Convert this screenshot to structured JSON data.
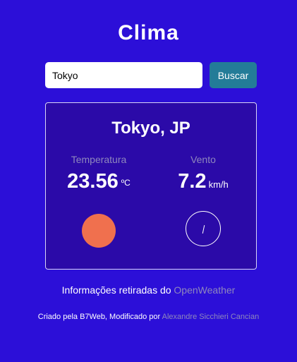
{
  "header": {
    "title": "Clima"
  },
  "search": {
    "value": "Tokyo",
    "button_label": "Buscar"
  },
  "result": {
    "city": "Tokyo, JP",
    "temperature": {
      "label": "Temperatura",
      "value": "23.56",
      "unit": "ºC",
      "indicator_color": "#f0704e"
    },
    "wind": {
      "label": "Vento",
      "value": "7.2",
      "unit": "km/h"
    }
  },
  "footer": {
    "source_text": "Informações retiradas do",
    "source_link": "OpenWeather",
    "credit_text": "Criado pela B7Web, Modificado por",
    "credit_link": "Alexandre Sicchieri Cancian"
  },
  "colors": {
    "background": "#2c0fd8",
    "card": "#2b0aa8",
    "button": "#237c98",
    "muted_text": "#8e87bd"
  }
}
